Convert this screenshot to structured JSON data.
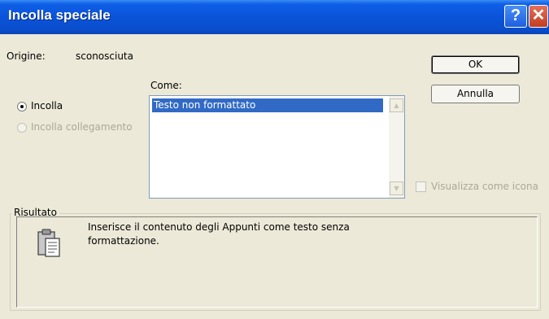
{
  "window": {
    "title": "Incolla speciale"
  },
  "titlebar": {
    "help_glyph": "?",
    "close_glyph": "✕"
  },
  "source": {
    "label": "Origine:",
    "value": "sconosciuta"
  },
  "buttons": {
    "ok": "OK",
    "cancel": "Annulla"
  },
  "paste_options": {
    "paste_label": "Incolla",
    "paste_link_label": "Incolla collegamento",
    "selected": "Incolla",
    "paste_link_enabled": false
  },
  "as_list": {
    "label": "Come:",
    "items": [
      "Testo non formattato"
    ],
    "selected_index": 0
  },
  "display_as_icon": {
    "label": "Visualizza come icona",
    "checked": false,
    "enabled": false
  },
  "result": {
    "legend": "Risultato",
    "description": "Inserisce il contenuto degli Appunti come testo senza formattazione."
  },
  "icons": {
    "help": "help-icon",
    "close": "close-icon",
    "clipboard": "clipboard-icon",
    "scroll_up": "scroll-up-arrow-icon",
    "scroll_down": "scroll-down-arrow-icon"
  },
  "colors": {
    "titlebar": "#0a53d8",
    "dialog_background": "#ece9d8",
    "selection": "#316ac5",
    "close_button": "#c33d1f"
  }
}
